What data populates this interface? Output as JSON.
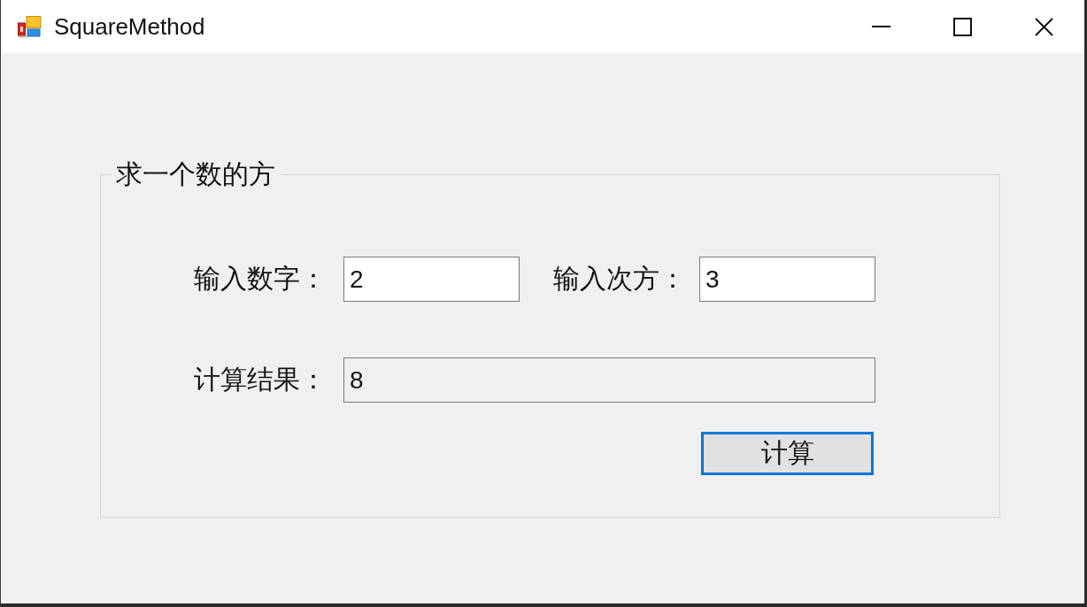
{
  "window": {
    "title": "SquareMethod"
  },
  "group": {
    "legend": "求一个数的方",
    "fields": [
      {
        "label": "输入数字：",
        "value": "2",
        "readonly": false
      },
      {
        "label": "输入次方：",
        "value": "3",
        "readonly": false
      },
      {
        "label": "计算结果：",
        "value": "8",
        "readonly": true
      }
    ],
    "button": {
      "label": "计算",
      "focused": true
    }
  }
}
